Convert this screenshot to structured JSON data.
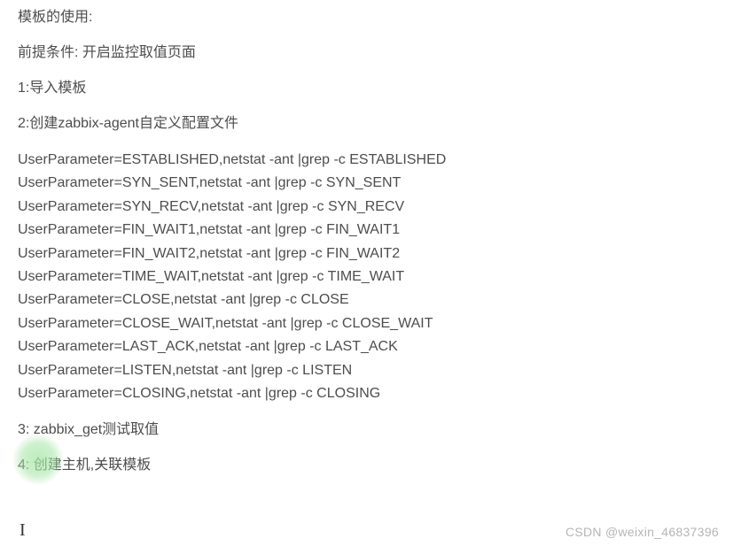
{
  "doc": {
    "title": "模板的使用:",
    "prereq": "前提条件:  开启监控取值页面",
    "step1": "1:导入模板",
    "step2": "2:创建zabbix-agent自定义配置文件",
    "params": [
      "UserParameter=ESTABLISHED,netstat -ant |grep -c ESTABLISHED",
      "UserParameter=SYN_SENT,netstat -ant |grep -c SYN_SENT",
      "UserParameter=SYN_RECV,netstat -ant |grep -c SYN_RECV",
      "UserParameter=FIN_WAIT1,netstat -ant |grep -c FIN_WAIT1",
      "UserParameter=FIN_WAIT2,netstat -ant |grep -c FIN_WAIT2",
      "UserParameter=TIME_WAIT,netstat -ant |grep -c TIME_WAIT",
      "UserParameter=CLOSE,netstat -ant |grep -c CLOSE",
      "UserParameter=CLOSE_WAIT,netstat -ant |grep -c CLOSE_WAIT",
      "UserParameter=LAST_ACK,netstat -ant |grep -c LAST_ACK",
      "UserParameter=LISTEN,netstat -ant |grep -c LISTEN",
      "UserParameter=CLOSING,netstat -ant |grep -c CLOSING"
    ],
    "step3": "3:  zabbix_get测试取值",
    "step4": "4:  创建主机,关联模板",
    "watermark": "CSDN @weixin_46837396"
  }
}
